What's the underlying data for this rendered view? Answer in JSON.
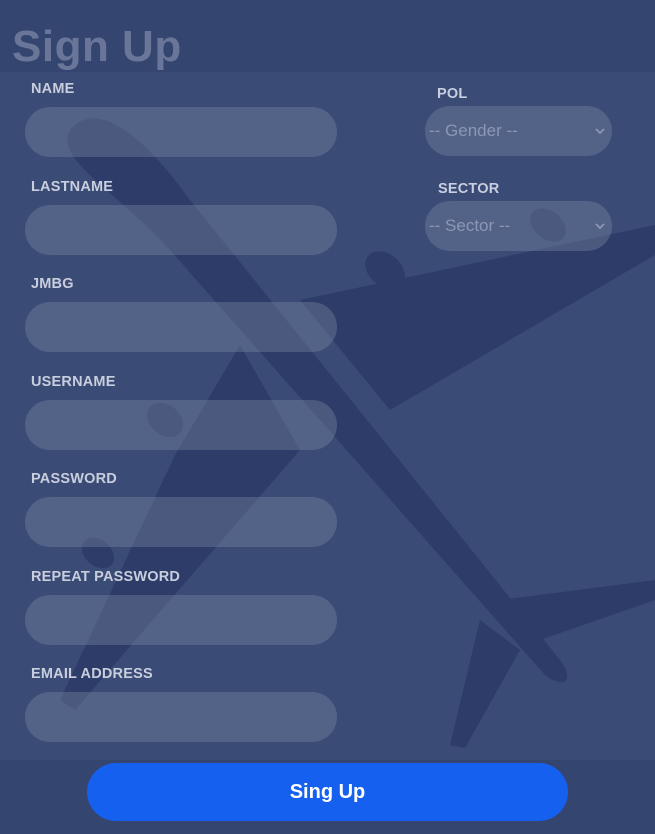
{
  "title": "Sign Up",
  "fields": {
    "name": {
      "label": "NAME",
      "value": ""
    },
    "lastname": {
      "label": "LASTNAME",
      "value": ""
    },
    "jmbg": {
      "label": "JMBG",
      "value": ""
    },
    "username": {
      "label": "USERNAME",
      "value": ""
    },
    "password": {
      "label": "PASSWORD",
      "value": ""
    },
    "repeat_password": {
      "label": "REPEAT PASSWORD",
      "value": ""
    },
    "email": {
      "label": "EMAIL ADDRESS",
      "value": ""
    }
  },
  "selects": {
    "gender": {
      "label": "POL",
      "selected": "-- Gender --"
    },
    "sector": {
      "label": "SECTOR",
      "selected": "-- Sector --"
    }
  },
  "submit_label": "Sing Up",
  "colors": {
    "background": "#3a4b76",
    "header_band": "#34456f",
    "button": "#1560ee",
    "title": "#6a7699"
  },
  "icons": {
    "select_arrow": "chevron-down-icon"
  }
}
